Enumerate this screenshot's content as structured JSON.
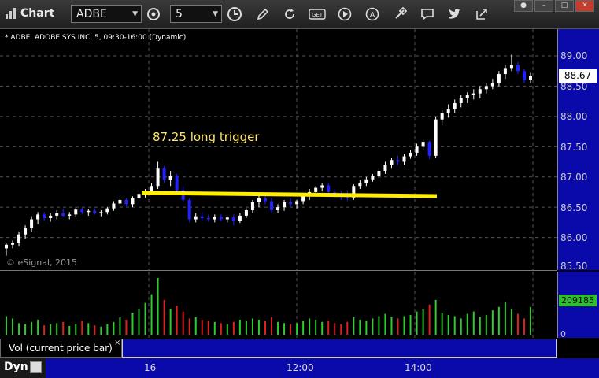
{
  "app": {
    "title": "Chart",
    "symbol": "ADBE",
    "interval": "5"
  },
  "chart_header": "* ADBE, ADOBE SYS INC, 5, 09:30-16:00 (Dynamic)",
  "watermark": "© eSignal, 2015",
  "annotation": {
    "text": "87.25 long trigger",
    "level": 87.25,
    "color": "#ffee00"
  },
  "price_axis": {
    "labels": [
      "89.00",
      "88.50",
      "88.00",
      "87.50",
      "87.00",
      "86.50",
      "86.00",
      "85.50"
    ],
    "last_price": "88.67"
  },
  "volume": {
    "label": "Vol (current price bar)",
    "close_glyph": "×",
    "current": "209185",
    "zero": "0"
  },
  "time_axis": {
    "labels": [
      "16",
      "12:00",
      "14:00"
    ]
  },
  "footer": {
    "dyn": "Dyn"
  },
  "colors": {
    "up": "#ffffff",
    "down": "#2222ff",
    "vol_up": "#2ecc2e",
    "vol_down": "#e02020",
    "axis_bg": "#0a0aaa"
  },
  "chart_data": {
    "type": "candlestick",
    "title": "ADBE, ADOBE SYS INC, 5",
    "ylim": [
      85.5,
      89.2
    ],
    "candles": [
      [
        85.82,
        85.9,
        85.7,
        85.88
      ],
      [
        85.88,
        85.95,
        85.82,
        85.91
      ],
      [
        85.91,
        86.1,
        85.85,
        86.05
      ],
      [
        86.05,
        86.2,
        85.98,
        86.15
      ],
      [
        86.15,
        86.35,
        86.1,
        86.3
      ],
      [
        86.3,
        86.42,
        86.22,
        86.38
      ],
      [
        86.38,
        86.42,
        86.28,
        86.32
      ],
      [
        86.32,
        86.4,
        86.26,
        86.36
      ],
      [
        86.36,
        86.45,
        86.3,
        86.4
      ],
      [
        86.4,
        86.48,
        86.33,
        86.36
      ],
      [
        86.36,
        86.42,
        86.3,
        86.38
      ],
      [
        86.38,
        86.5,
        86.34,
        86.46
      ],
      [
        86.46,
        86.5,
        86.38,
        86.42
      ],
      [
        86.42,
        86.47,
        86.36,
        86.44
      ],
      [
        86.44,
        86.48,
        86.38,
        86.4
      ],
      [
        86.4,
        86.45,
        86.35,
        86.42
      ],
      [
        86.42,
        86.5,
        86.38,
        86.48
      ],
      [
        86.48,
        86.6,
        86.44,
        86.56
      ],
      [
        86.56,
        86.65,
        86.5,
        86.62
      ],
      [
        86.62,
        86.65,
        86.52,
        86.55
      ],
      [
        86.55,
        86.68,
        86.5,
        86.65
      ],
      [
        86.65,
        86.75,
        86.6,
        86.72
      ],
      [
        86.72,
        86.8,
        86.66,
        86.75
      ],
      [
        86.75,
        86.9,
        86.7,
        86.85
      ],
      [
        86.85,
        87.25,
        86.8,
        87.15
      ],
      [
        87.15,
        87.18,
        86.9,
        86.95
      ],
      [
        86.95,
        87.1,
        86.85,
        87.02
      ],
      [
        87.02,
        87.05,
        86.7,
        86.78
      ],
      [
        86.78,
        86.85,
        86.58,
        86.62
      ],
      [
        86.62,
        86.65,
        86.25,
        86.3
      ],
      [
        86.3,
        86.4,
        86.25,
        86.35
      ],
      [
        86.35,
        86.42,
        86.28,
        86.32
      ],
      [
        86.32,
        86.38,
        86.26,
        86.3
      ],
      [
        86.3,
        86.38,
        86.25,
        86.34
      ],
      [
        86.34,
        86.38,
        86.27,
        86.3
      ],
      [
        86.3,
        86.35,
        86.25,
        86.33
      ],
      [
        86.33,
        86.38,
        86.2,
        86.28
      ],
      [
        86.28,
        86.4,
        86.24,
        86.36
      ],
      [
        86.36,
        86.48,
        86.32,
        86.45
      ],
      [
        86.45,
        86.62,
        86.4,
        86.58
      ],
      [
        86.58,
        86.7,
        86.5,
        86.65
      ],
      [
        86.65,
        86.7,
        86.55,
        86.6
      ],
      [
        86.6,
        86.66,
        86.4,
        86.45
      ],
      [
        86.45,
        86.55,
        86.4,
        86.5
      ],
      [
        86.5,
        86.62,
        86.44,
        86.58
      ],
      [
        86.58,
        86.65,
        86.5,
        86.55
      ],
      [
        86.55,
        86.62,
        86.48,
        86.6
      ],
      [
        86.6,
        86.72,
        86.55,
        86.7
      ],
      [
        86.7,
        86.8,
        86.62,
        86.75
      ],
      [
        86.75,
        86.85,
        86.7,
        86.82
      ],
      [
        86.82,
        86.9,
        86.76,
        86.86
      ],
      [
        86.86,
        86.9,
        86.7,
        86.75
      ],
      [
        86.75,
        86.8,
        86.66,
        86.7
      ],
      [
        86.7,
        86.78,
        86.62,
        86.68
      ],
      [
        86.68,
        86.78,
        86.6,
        86.66
      ],
      [
        86.66,
        86.88,
        86.62,
        86.85
      ],
      [
        86.85,
        86.95,
        86.8,
        86.9
      ],
      [
        86.9,
        87.0,
        86.85,
        86.96
      ],
      [
        86.96,
        87.05,
        86.92,
        87.02
      ],
      [
        87.02,
        87.15,
        86.98,
        87.1
      ],
      [
        87.1,
        87.25,
        87.05,
        87.2
      ],
      [
        87.2,
        87.32,
        87.15,
        87.28
      ],
      [
        87.28,
        87.35,
        87.2,
        87.25
      ],
      [
        87.25,
        87.38,
        87.2,
        87.34
      ],
      [
        87.34,
        87.45,
        87.3,
        87.4
      ],
      [
        87.4,
        87.55,
        87.35,
        87.5
      ],
      [
        87.5,
        87.62,
        87.44,
        87.58
      ],
      [
        87.58,
        87.6,
        87.3,
        87.35
      ],
      [
        87.35,
        88.0,
        87.32,
        87.95
      ],
      [
        87.95,
        88.1,
        87.85,
        88.05
      ],
      [
        88.05,
        88.2,
        87.98,
        88.12
      ],
      [
        88.12,
        88.28,
        88.05,
        88.22
      ],
      [
        88.22,
        88.35,
        88.15,
        88.3
      ],
      [
        88.3,
        88.4,
        88.22,
        88.36
      ],
      [
        88.36,
        88.45,
        88.28,
        88.38
      ],
      [
        88.38,
        88.5,
        88.3,
        88.45
      ],
      [
        88.45,
        88.55,
        88.38,
        88.5
      ],
      [
        88.5,
        88.62,
        88.45,
        88.55
      ],
      [
        88.55,
        88.75,
        88.5,
        88.7
      ],
      [
        88.7,
        88.85,
        88.62,
        88.8
      ],
      [
        88.8,
        89.02,
        88.75,
        88.85
      ],
      [
        88.85,
        88.9,
        88.7,
        88.75
      ],
      [
        88.75,
        88.78,
        88.55,
        88.6
      ],
      [
        88.6,
        88.72,
        88.55,
        88.67
      ]
    ],
    "volumes": [
      32,
      28,
      20,
      18,
      22,
      26,
      16,
      18,
      20,
      22,
      15,
      18,
      24,
      20,
      16,
      14,
      18,
      22,
      30,
      26,
      38,
      45,
      55,
      70,
      98,
      60,
      45,
      50,
      40,
      28,
      30,
      26,
      24,
      22,
      20,
      18,
      22,
      26,
      24,
      28,
      26,
      24,
      30,
      22,
      20,
      18,
      20,
      24,
      28,
      26,
      22,
      24,
      20,
      18,
      22,
      30,
      26,
      24,
      28,
      32,
      36,
      30,
      28,
      32,
      34,
      40,
      44,
      52,
      60,
      38,
      34,
      32,
      28,
      36,
      40,
      30,
      34,
      42,
      48,
      56,
      44,
      36,
      28,
      48
    ]
  }
}
